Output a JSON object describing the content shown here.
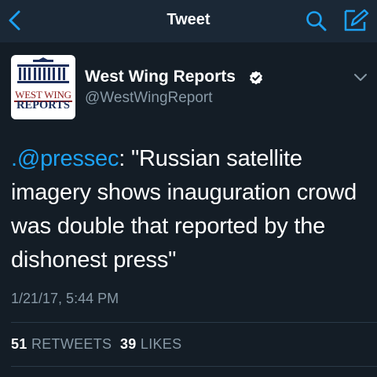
{
  "header": {
    "title": "Tweet"
  },
  "author": {
    "display_name": "West Wing Reports",
    "handle": "@WestWingReport",
    "avatar_text_line1": "WEST WING",
    "avatar_text_line2": "REPORTS",
    "verified": true
  },
  "tweet": {
    "mention": ".@pressec",
    "body": ": \"Russian satellite imagery shows inauguration crowd was double that reported by the dishonest press\"",
    "timestamp": "1/21/17, 5:44 PM"
  },
  "stats": {
    "retweets_count": "51",
    "retweets_label": "RETWEETS",
    "likes_count": "39",
    "likes_label": "LIKES"
  },
  "colors": {
    "background": "#141d26",
    "navbar": "#1b2836",
    "accent": "#1da1f2",
    "secondary_text": "#8899a6"
  },
  "icons": {
    "back": "chevron-left-icon",
    "search": "search-icon",
    "compose": "compose-icon",
    "verified": "verified-badge-icon",
    "more": "chevron-down-icon"
  }
}
